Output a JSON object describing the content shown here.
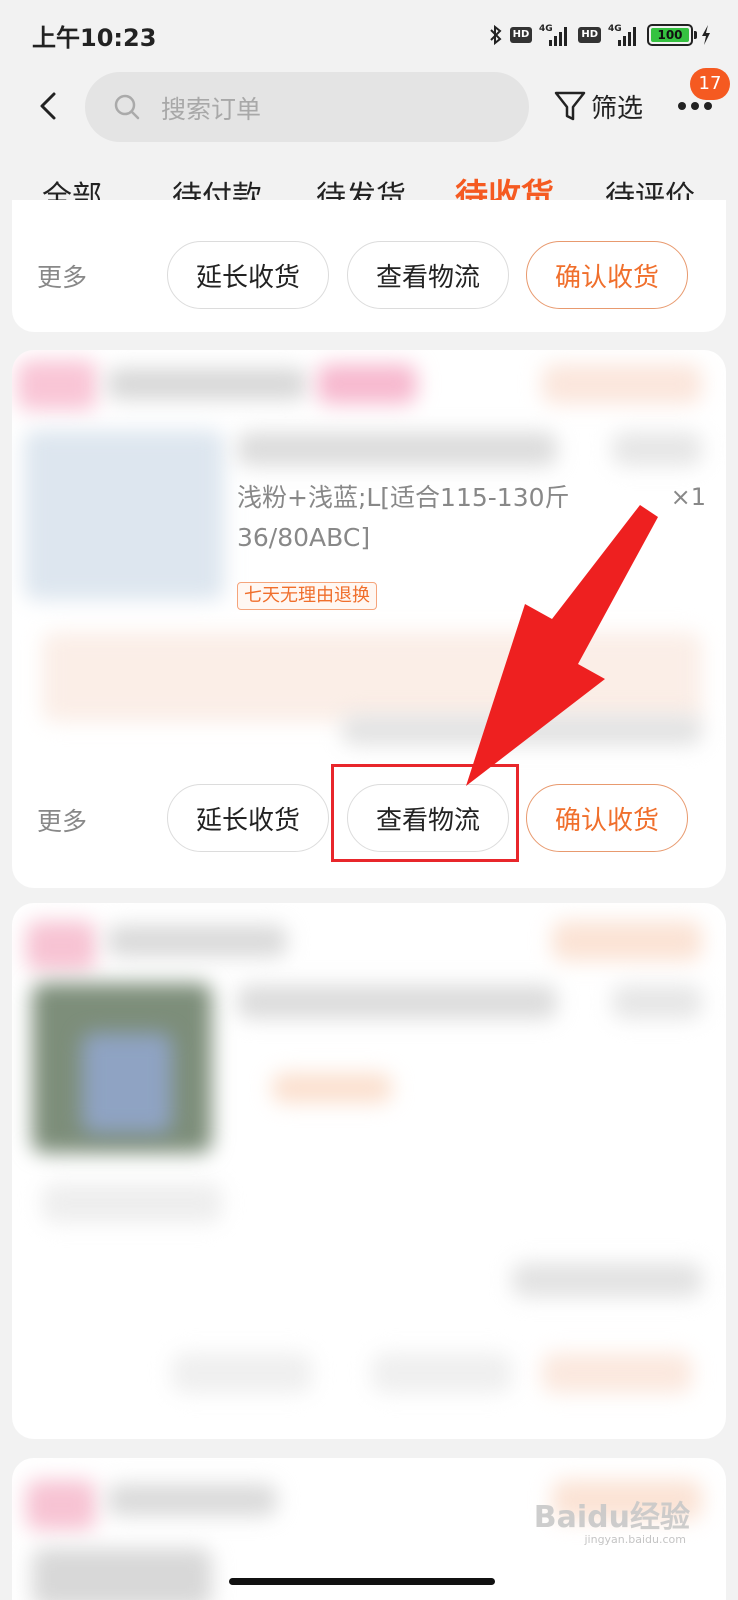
{
  "status_bar": {
    "time": "上午10:23",
    "hd_label": "HD",
    "network_label": "4G",
    "battery_level": "100"
  },
  "header": {
    "search_placeholder": "搜索订单",
    "filter_label": "筛选",
    "notification_count": "17"
  },
  "tabs": [
    {
      "label": "全部",
      "active": false
    },
    {
      "label": "待付款",
      "active": false
    },
    {
      "label": "待发货",
      "active": false
    },
    {
      "label": "待收货",
      "active": true
    },
    {
      "label": "待评价",
      "active": false
    }
  ],
  "order_actions": {
    "more_label": "更多",
    "extend_label": "延长收货",
    "logistics_label": "查看物流",
    "confirm_label": "确认收货"
  },
  "order_item": {
    "spec": "浅粉+浅蓝;L[适合115-130斤 36/80ABC]",
    "quantity": "×1",
    "return_tag": "七天无理由退换"
  },
  "watermark": {
    "text": "Baidu经验",
    "sub": "jingyan.baidu.com"
  },
  "colors": {
    "accent": "#f55a21",
    "annotation": "#e8262b",
    "background": "#f2f2f2"
  }
}
